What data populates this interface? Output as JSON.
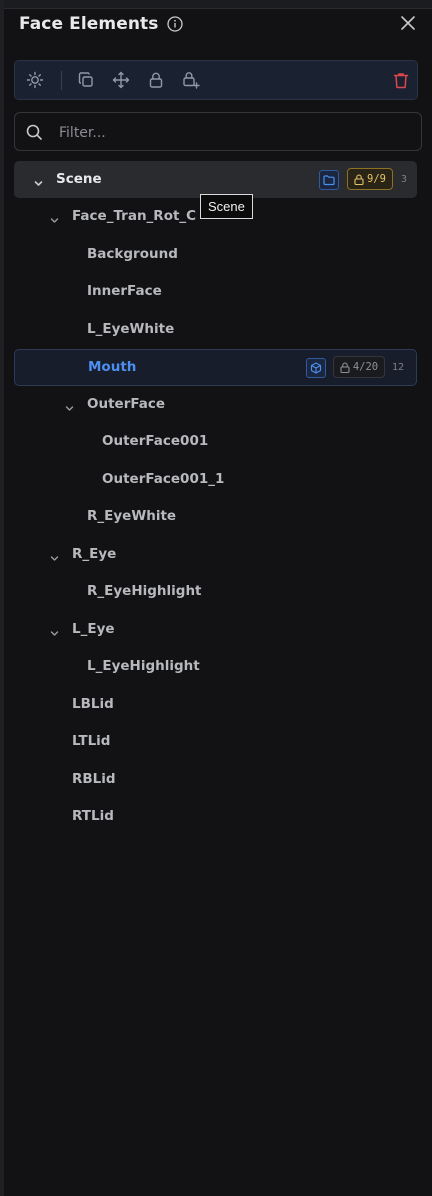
{
  "panel": {
    "title": "Face Elements",
    "info_icon": "info-icon",
    "close_icon": "close-icon"
  },
  "toolbar": {
    "buttons": [
      {
        "name": "visibility",
        "icon": "sun-icon"
      },
      {
        "name": "duplicate",
        "icon": "copy-icon"
      },
      {
        "name": "move",
        "icon": "move-arrows-icon"
      },
      {
        "name": "lock",
        "icon": "lock-icon"
      },
      {
        "name": "lock-add",
        "icon": "lock-plus-icon"
      },
      {
        "name": "delete",
        "icon": "trash-icon"
      }
    ],
    "delete_color": "#e0474c"
  },
  "search": {
    "placeholder": "Filter...",
    "value": ""
  },
  "tree": {
    "scene": {
      "label": "Scene",
      "lock_badge": "9/9",
      "count": "3"
    },
    "items": [
      {
        "label": "Face_Tran_Rot_C"
      },
      {
        "label": "Background"
      },
      {
        "label": "InnerFace"
      },
      {
        "label": "L_EyeWhite"
      },
      {
        "label": "Mouth",
        "lock_badge": "4/20",
        "count": "12"
      },
      {
        "label": "OuterFace"
      },
      {
        "label": "OuterFace001"
      },
      {
        "label": "OuterFace001_1"
      },
      {
        "label": "R_EyeWhite"
      },
      {
        "label": "R_Eye"
      },
      {
        "label": "R_EyeHighlight"
      },
      {
        "label": "L_Eye"
      },
      {
        "label": "L_EyeHighlight"
      },
      {
        "label": "LBLid"
      },
      {
        "label": "LTLid"
      },
      {
        "label": "RBLid"
      },
      {
        "label": "RTLid"
      }
    ]
  },
  "tooltip": {
    "text": "Scene"
  },
  "colors": {
    "accent": "#4d8ff0",
    "lock_badge": "#e3c36a",
    "background": "#121215"
  }
}
